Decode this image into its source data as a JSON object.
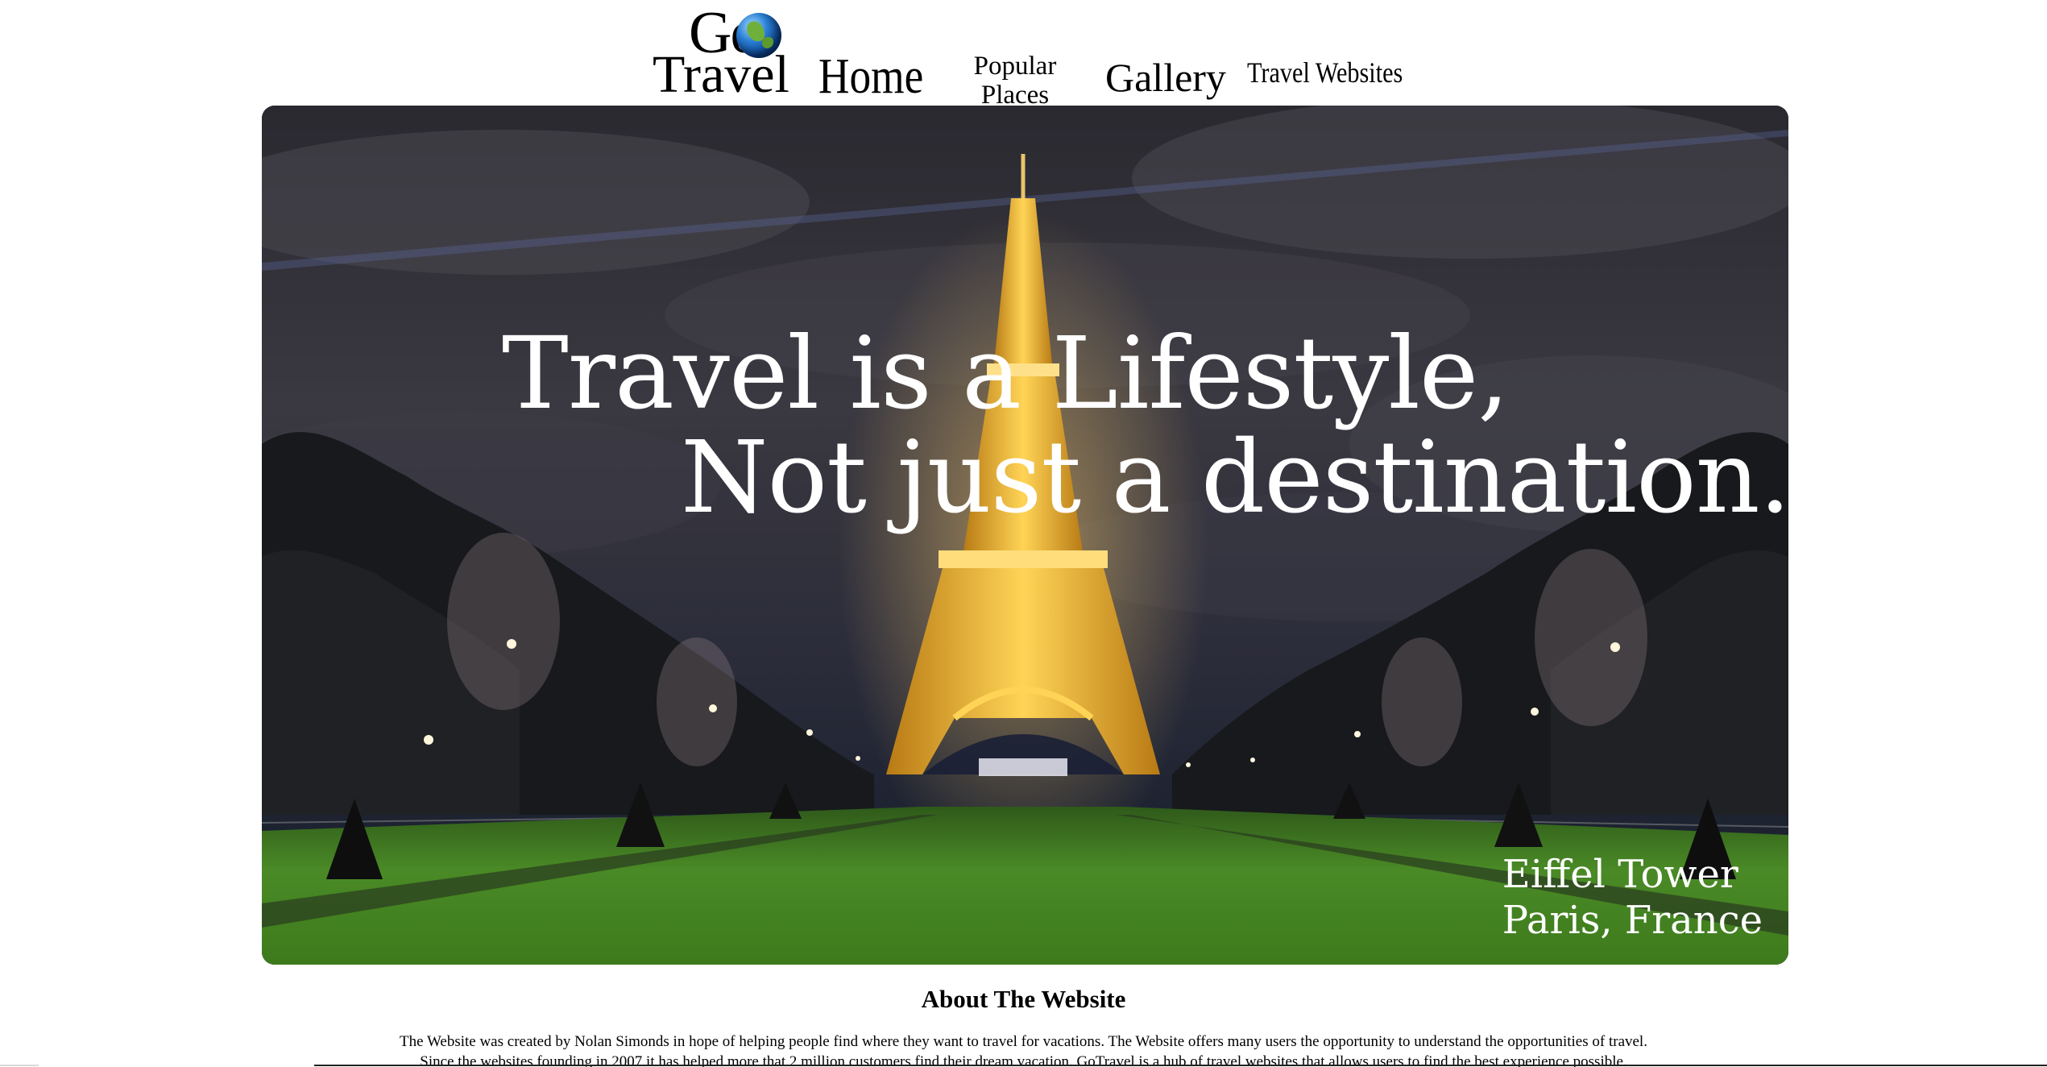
{
  "header": {
    "logo": {
      "go_text": "Go",
      "travel_text": "Travel"
    },
    "nav": {
      "home": "Home",
      "popular_line1": "Popular",
      "popular_line2": "Places",
      "gallery": "Gallery",
      "travel_websites": "Travel Websites"
    }
  },
  "hero": {
    "headline_line1": "Travel is a Lifestyle,",
    "headline_line2": "Not just a destination.",
    "caption_line1": "Eiffel Tower",
    "caption_line2": "Paris, France"
  },
  "about": {
    "title": "About The Website",
    "line1": "The Website was created by Nolan Simonds in hope of helping people find where they want to travel for vacations. The Website offers many users the opportunity to understand the opportunities of travel.",
    "line2": "Since the websites founding in 2007 it has helped more that 2 million customers find their dream vacation. GoTravel is a hub of travel websites that allows users to find the best experience possible."
  },
  "colors": {
    "page_background": "#ffffff",
    "hero_text": "#ffffff",
    "sky": "#24232d",
    "tower_light": "#f2b533",
    "grass": "#3f7a21"
  }
}
